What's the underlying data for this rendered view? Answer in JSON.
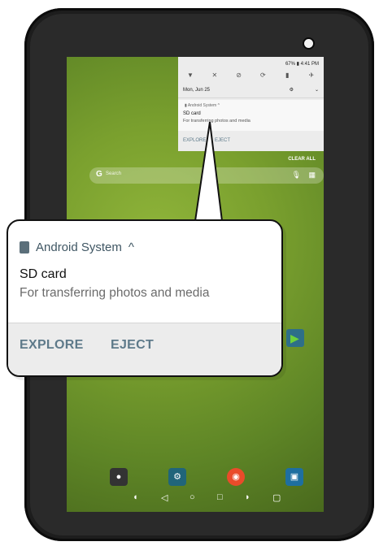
{
  "status": {
    "battery_text": "67%",
    "time": "4:41 PM"
  },
  "quick_settings": {
    "date": "Mon, Jun 25",
    "icons": [
      "wifi-icon",
      "bluetooth-off-icon",
      "dnd-icon",
      "auto-rotate-icon",
      "flashlight-icon",
      "airplane-mode-icon"
    ],
    "settings_icon": "gear-icon",
    "expand_icon": "chevron-down-icon"
  },
  "notification": {
    "app_name": "Android System",
    "expand_glyph": "^",
    "title": "SD card",
    "text": "For transferring photos and media",
    "actions": {
      "explore": "EXPLORE",
      "eject": "EJECT"
    }
  },
  "clear_all": "CLEAR ALL",
  "search": {
    "glyph": "G",
    "placeholder": "Search"
  },
  "colors": {
    "action_text": "#5e7a8a",
    "wallpaper": "#7aa02e"
  }
}
